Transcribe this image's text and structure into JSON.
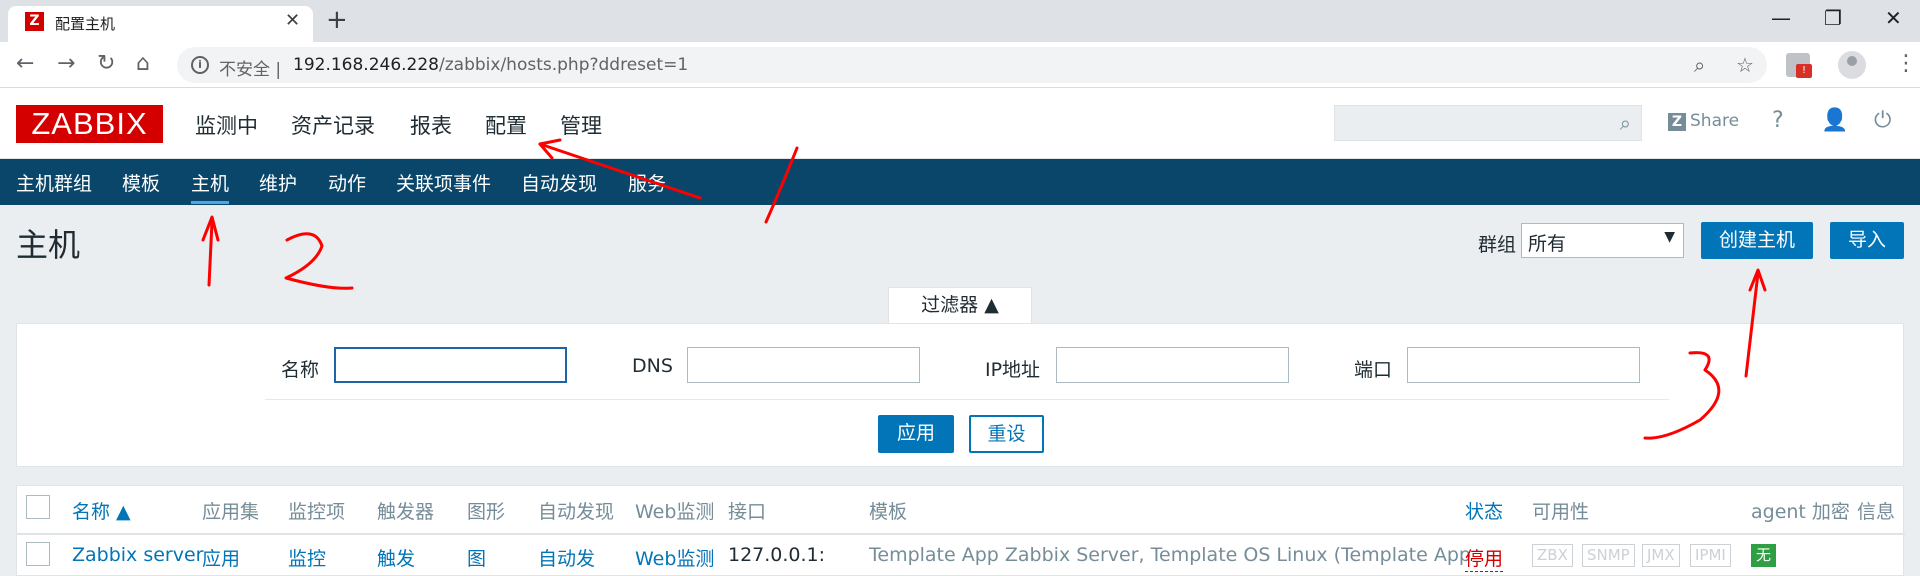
{
  "browser": {
    "tab_title": "配置主机",
    "favicon_letter": "Z",
    "url_insecure_label": "不安全",
    "url_separator": "|",
    "url_host": "192.168.246.228",
    "url_path": "/zabbix/hosts.php?ddreset=1"
  },
  "header": {
    "logo": "ZABBIX",
    "menu": [
      "监测中",
      "资产记录",
      "报表",
      "配置",
      "管理"
    ],
    "share_label": "Share"
  },
  "subnav": [
    "主机群组",
    "模板",
    "主机",
    "维护",
    "动作",
    "关联项事件",
    "自动发现",
    "服务"
  ],
  "page": {
    "title": "主机",
    "group_label": "群组",
    "group_value": "所有",
    "create_button": "创建主机",
    "import_button": "导入"
  },
  "filter": {
    "tab_label": "过滤器 ▲",
    "name_label": "名称",
    "dns_label": "DNS",
    "ip_label": "IP地址",
    "port_label": "端口",
    "apply_button": "应用",
    "reset_button": "重设"
  },
  "table": {
    "headers": [
      "名称 ▲",
      "应用集",
      "监控项",
      "触发器",
      "图形",
      "自动发现",
      "Web监测",
      "接口",
      "模板",
      "状态",
      "可用性",
      "agent 加密",
      "信息"
    ],
    "row": {
      "name": "Zabbix server",
      "applications": "应用",
      "items": "监控",
      "triggers": "触发",
      "graphs": "图",
      "discovery": "自动发",
      "web": "Web监测",
      "interface": "127.0.0.1:",
      "template_1": "Template App Zabbix Server",
      "sep_1": ",",
      "template_2": "Template OS Linux",
      "template_3": "(Template App",
      "status": "停用",
      "availability": [
        "ZBX",
        "SNMP",
        "JMX",
        "IPMI"
      ],
      "encryption": "无"
    }
  },
  "annotations": [
    "1",
    "2",
    "3"
  ],
  "colors": {
    "brand_red": "#d40000",
    "nav_blue": "#0a466a",
    "link_blue": "#0275b8",
    "marker_red": "#ff0000"
  }
}
